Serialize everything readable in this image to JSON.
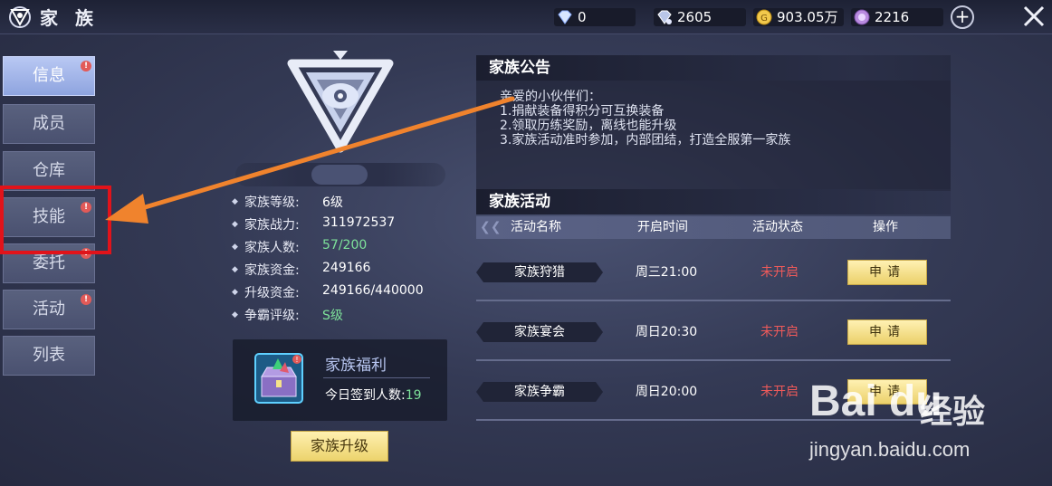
{
  "header": {
    "title": "家 族",
    "currencies": [
      {
        "icon": "diamond-icon",
        "value": "0"
      },
      {
        "icon": "bound-diamond-icon",
        "value": "2605"
      },
      {
        "icon": "gold-coin-icon",
        "value": "903.05万"
      },
      {
        "icon": "contribution-coin-icon",
        "value": "2216"
      }
    ]
  },
  "sidebar": {
    "items": [
      {
        "label": "信息",
        "badge": "!",
        "active": true
      },
      {
        "label": "成员",
        "badge": "",
        "active": false
      },
      {
        "label": "仓库",
        "badge": "",
        "active": false
      },
      {
        "label": "技能",
        "badge": "!",
        "active": false
      },
      {
        "label": "委托",
        "badge": "!",
        "active": false
      },
      {
        "label": "活动",
        "badge": "!",
        "active": false
      },
      {
        "label": "列表",
        "badge": "",
        "active": false
      }
    ]
  },
  "family": {
    "stats": [
      {
        "label": "家族等级:",
        "value": "6级",
        "color": "#ffffff"
      },
      {
        "label": "家族战力:",
        "value": "311972537",
        "color": "#ffffff"
      },
      {
        "label": "家族人数:",
        "value": "57/200",
        "color": "#7ee29a"
      },
      {
        "label": "家族资金:",
        "value": "249166",
        "color": "#ffffff"
      },
      {
        "label": "升级资金:",
        "value": "249166/440000",
        "color": "#ffffff"
      },
      {
        "label": "争霸评级:",
        "value": "S级",
        "color": "#7ee29a"
      }
    ],
    "welfare": {
      "title": "家族福利",
      "signin_label": "今日签到人数:",
      "signin_count": "19",
      "badge": "!"
    },
    "upgrade_label": "家族升级"
  },
  "notice": {
    "title": "家族公告",
    "lines": [
      "亲爱的小伙伴们：",
      "1.捐献装备得积分可互换装备",
      "2.领取历练奖励，离线也能升级",
      "3.家族活动准时参加，内部团结，打造全服第一家族"
    ]
  },
  "activities": {
    "title": "家族活动",
    "columns": [
      "活动名称",
      "开启时间",
      "活动状态",
      "操作"
    ],
    "rows": [
      {
        "name": "家族狩猎",
        "time": "周三21:00",
        "status": "未开启",
        "action": "申请"
      },
      {
        "name": "家族宴会",
        "time": "周日20:30",
        "status": "未开启",
        "action": "申请"
      },
      {
        "name": "家族争霸",
        "time": "周日20:00",
        "status": "未开启",
        "action": "申请"
      }
    ]
  },
  "watermark": {
    "logo": "Bai du",
    "cn": "经验",
    "url": "jingyan.baidu.com"
  },
  "colors": {
    "highlight_box": "#e1131a",
    "arrow": "#f0832d",
    "status_red": "#ef5a5a",
    "accent_green": "#7ee29a",
    "button_gold": "#ecd36c"
  }
}
